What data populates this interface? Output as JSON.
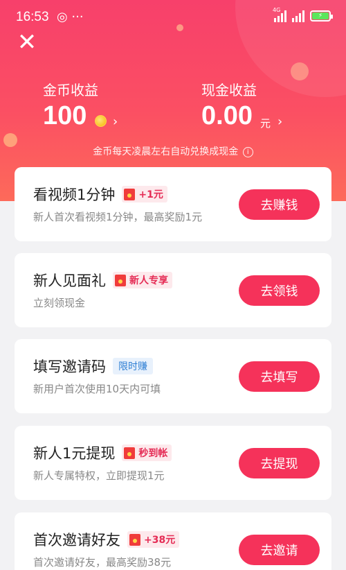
{
  "status_bar": {
    "time": "16:53",
    "left_icons": "◎ ···",
    "network": "4G",
    "battery_charging_symbol": "⚡"
  },
  "header": {
    "close_symbol": "✕",
    "coin_income": {
      "label": "金币收益",
      "value": "100",
      "chevron": "›"
    },
    "cash_income": {
      "label": "现金收益",
      "value": "0.00",
      "unit": "元",
      "chevron": "›"
    },
    "note": "金币每天凌晨左右自动兑换成现金",
    "info_symbol": "i"
  },
  "tasks": [
    {
      "title": "看视频1分钟",
      "badge": "+1元",
      "badge_style": "red",
      "desc": "新人首次看视频1分钟，最高奖励1元",
      "button": "去赚钱"
    },
    {
      "title": "新人见面礼",
      "badge": "新人专享",
      "badge_style": "red",
      "desc": "立刻领现金",
      "button": "去领钱"
    },
    {
      "title": "填写邀请码",
      "badge": "限时赚",
      "badge_style": "blue",
      "desc": "新用户首次使用10天内可填",
      "button": "去填写"
    },
    {
      "title": "新人1元提现",
      "badge": "秒到帐",
      "badge_style": "red",
      "desc": "新人专属特权，立即提现1元",
      "button": "去提现"
    },
    {
      "title": "首次邀请好友",
      "badge": "+38元",
      "badge_style": "red",
      "desc": "首次邀请好友，最高奖励38元",
      "button": "去邀请"
    }
  ],
  "colors": {
    "accent": "#f5325a",
    "header_top": "#f7406b",
    "header_bottom": "#fd6a5a"
  }
}
